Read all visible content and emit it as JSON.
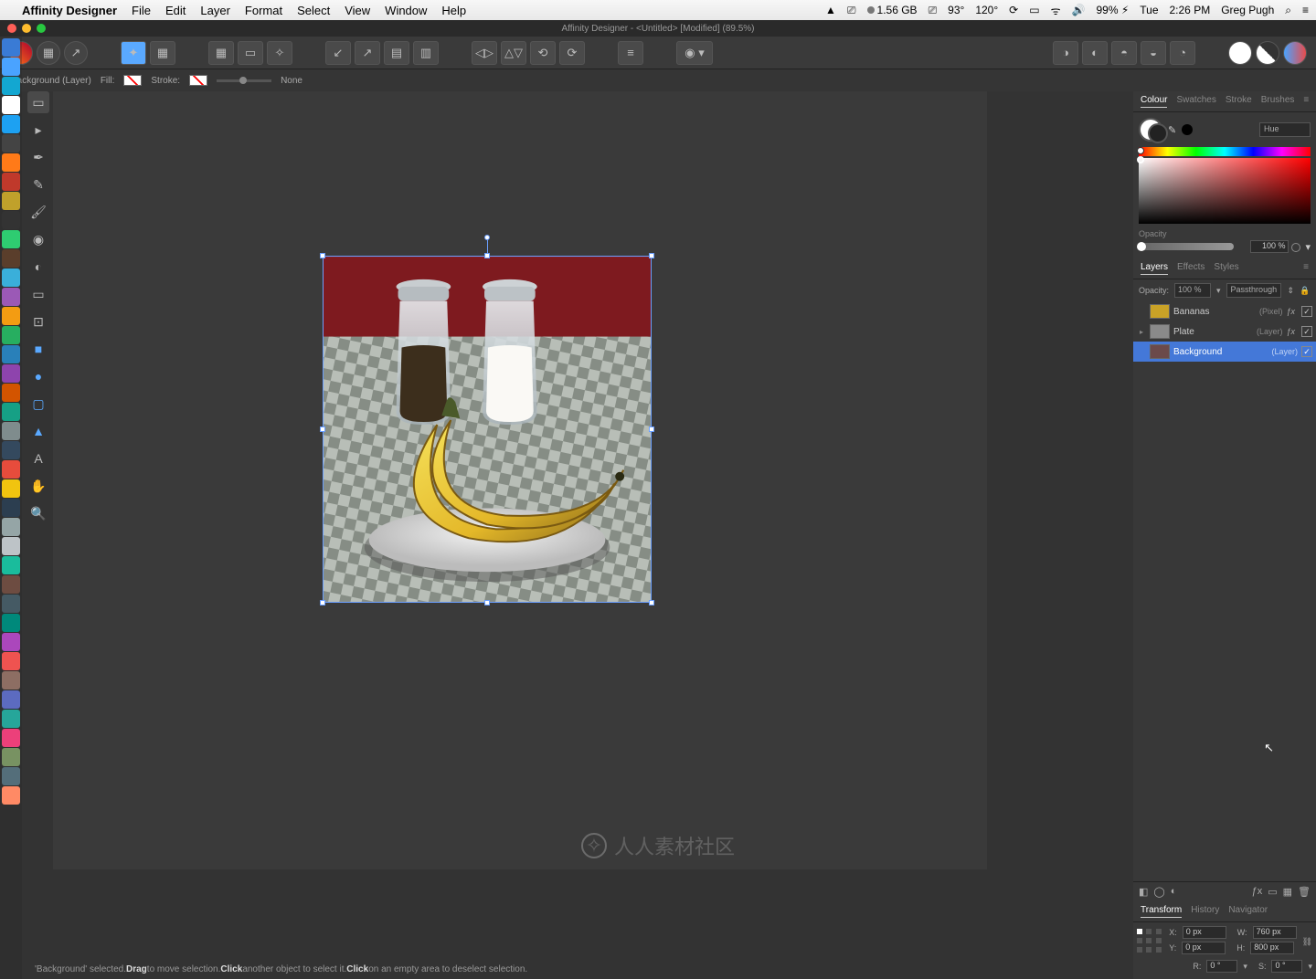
{
  "menubar": {
    "app": "Affinity Designer",
    "items": [
      "File",
      "Edit",
      "Layer",
      "Format",
      "Select",
      "View",
      "Window",
      "Help"
    ],
    "status": {
      "cloud": "▲",
      "cam": "⎚",
      "ram": "1.56 GB",
      "disp": "⎚",
      "temp1": "93°",
      "temp2": "120°",
      "refresh": "⟳",
      "wifi": "ᯤ",
      "vol": "🔊",
      "battery": "99% ⚡︎",
      "day": "Tue",
      "time": "2:26 PM",
      "user": "Greg Pugh",
      "search": "⌕",
      "menu": "≡"
    }
  },
  "titlebar": {
    "title": "Affinity Designer - <Untitled> [Modified] (89.5%)"
  },
  "contextbar": {
    "selection": "Background (Layer)",
    "fill": "Fill:",
    "stroke": "Stroke:",
    "strokeVal": "None"
  },
  "panels": {
    "colour": {
      "tabs": [
        "Colour",
        "Swatches",
        "Stroke",
        "Brushes"
      ],
      "mode": "Hue",
      "opacityLabel": "Opacity",
      "opacity": "100 %"
    },
    "layers": {
      "tabs": [
        "Layers",
        "Effects",
        "Styles"
      ],
      "opacityLabel": "Opacity:",
      "opacity": "100 %",
      "blend": "Passthrough",
      "items": [
        {
          "name": "Bananas",
          "type": "(Pixel)",
          "fx": true,
          "vis": true,
          "thumb": "#c9a227"
        },
        {
          "name": "Plate",
          "type": "(Layer)",
          "fx": true,
          "vis": true,
          "disclose": true,
          "thumb": "#8a8a8a"
        },
        {
          "name": "Background",
          "type": "(Layer)",
          "fx": false,
          "vis": true,
          "sel": true,
          "thumb": "#6b4a4a"
        }
      ]
    },
    "transform": {
      "tabs": [
        "Transform",
        "History",
        "Navigator"
      ],
      "x": "0 px",
      "y": "0 px",
      "w": "760 px",
      "h": "800 px",
      "r": "0 °",
      "s": "0 °"
    }
  },
  "statusbar": {
    "pre": "'Background' selected. ",
    "b1": "Drag",
    "t1": " to move selection. ",
    "b2": "Click",
    "t2": " another object to select it. ",
    "b3": "Click",
    "t3": " on an empty area to deselect selection."
  },
  "watermark": "人人素材社区"
}
